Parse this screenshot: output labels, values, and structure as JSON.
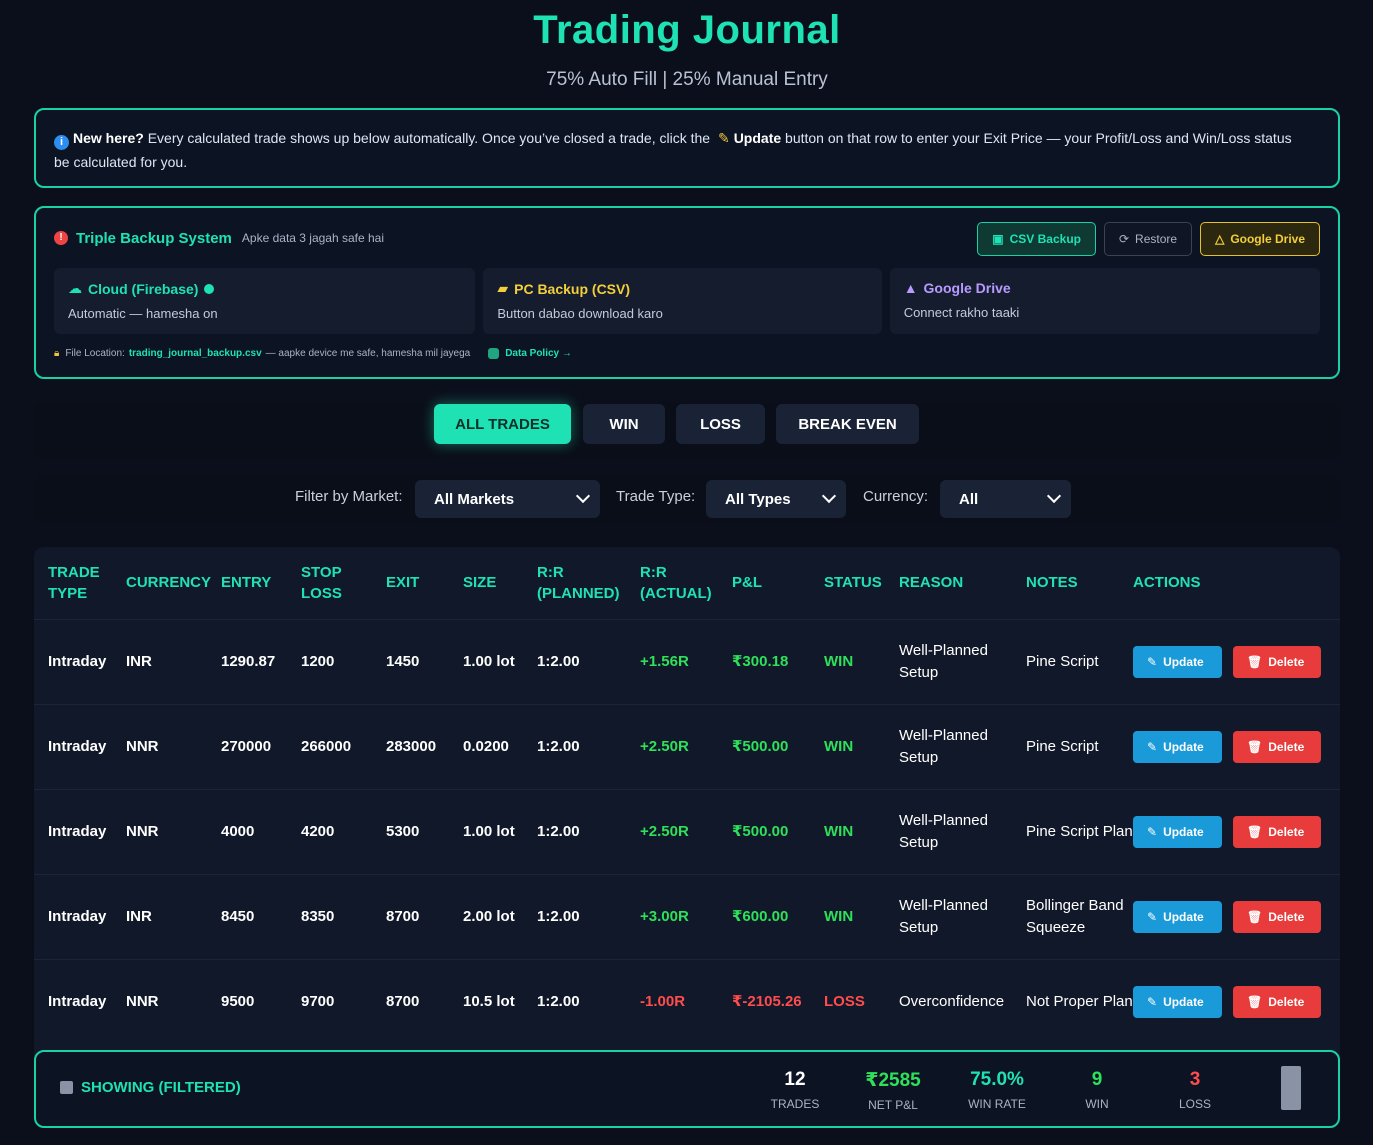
{
  "header": {
    "title": "Trading Journal",
    "subtitle": "75% Auto Fill | 25% Manual Entry"
  },
  "info": {
    "icon": "info-icon",
    "lead": "New here?",
    "text1": " Every calculated trade shows up below automatically. Once you’ve closed a trade, click the ",
    "update_word": "Update",
    "text2": " button on that row to enter your Exit Price — your Profit/Loss and Win/Loss status ",
    "text3": "be calculated for you."
  },
  "backup": {
    "title": "Triple Backup System",
    "subtitle": "Apke data 3 jagah safe hai",
    "buttons": {
      "csv": "CSV Backup",
      "restore": "Restore",
      "gdrive": "Google Drive"
    },
    "cards": [
      {
        "title": "Cloud (Firebase)",
        "sub": "Automatic — hamesha on",
        "icon": "cloud-icon"
      },
      {
        "title": "PC Backup (CSV)",
        "sub": "Button dabao download karo",
        "icon": "folder-icon"
      },
      {
        "title": "Google Drive",
        "sub": "Connect rakho taaki",
        "icon": "drive-icon"
      }
    ],
    "file_label": "File Location:",
    "file_name": "trading_journal_backup.csv",
    "file_note": "— aapke device me safe, hamesha mil jayega",
    "data_policy": "Data Policy →"
  },
  "tabs": [
    "ALL TRADES",
    "WIN",
    "LOSS",
    "BREAK EVEN"
  ],
  "filters": {
    "market_label": "Filter by Market:",
    "market_value": "All Markets",
    "type_label": "Trade Type:",
    "type_value": "All Types",
    "currency_label": "Currency:",
    "currency_value": "All"
  },
  "table": {
    "headers": [
      "TRADE TYPE",
      "CURRENCY",
      "ENTRY",
      "STOP LOSS",
      "EXIT",
      "SIZE",
      "R:R (PLANNED)",
      "R:R (ACTUAL)",
      "P&L",
      "STATUS",
      "REASON",
      "NOTES",
      "ACTIONS"
    ],
    "update_label": "Update",
    "delete_label": "Delete",
    "rows": [
      {
        "type": "Intraday",
        "currency": "INR",
        "entry": "1290.87",
        "stop": "1200",
        "exit": "1450",
        "size": "1.00 lot",
        "rr_planned": "1:2.00",
        "rr_actual": "+1.56R",
        "pnl": "₹300.18",
        "status": "WIN",
        "reason": "Well-Planned Setup",
        "notes": "Pine Script",
        "positive": true
      },
      {
        "type": "Intraday",
        "currency": "NNR",
        "entry": "270000",
        "stop": "266000",
        "exit": "283000",
        "size": "0.0200",
        "rr_planned": "1:2.00",
        "rr_actual": "+2.50R",
        "pnl": "₹500.00",
        "status": "WIN",
        "reason": "Well-Planned Setup",
        "notes": "Pine Script",
        "positive": true
      },
      {
        "type": "Intraday",
        "currency": "NNR",
        "entry": "4000",
        "stop": "4200",
        "exit": "5300",
        "size": "1.00 lot",
        "rr_planned": "1:2.00",
        "rr_actual": "+2.50R",
        "pnl": "₹500.00",
        "status": "WIN",
        "reason": "Well-Planned Setup",
        "notes": "Pine Script Plan",
        "positive": true
      },
      {
        "type": "Intraday",
        "currency": "INR",
        "entry": "8450",
        "stop": "8350",
        "exit": "8700",
        "size": "2.00 lot",
        "rr_planned": "1:2.00",
        "rr_actual": "+3.00R",
        "pnl": "₹600.00",
        "status": "WIN",
        "reason": "Well-Planned Setup",
        "notes": "Bollinger Band Squeeze",
        "positive": true
      },
      {
        "type": "Intraday",
        "currency": "NNR",
        "entry": "9500",
        "stop": "9700",
        "exit": "8700",
        "size": "10.5 lot",
        "rr_planned": "1:2.00",
        "rr_actual": "-1.00R",
        "pnl": "₹-2105.26",
        "status": "LOSS",
        "reason": "Overconfidence",
        "notes": "Not Proper Plan",
        "positive": false
      }
    ]
  },
  "summary": {
    "title": "SHOWING (FILTERED)",
    "stats": [
      {
        "value": "12",
        "label": "TRADES",
        "color": "#ffffff"
      },
      {
        "value": "₹2585",
        "label": "NET P&L",
        "color": "#2ee05a"
      },
      {
        "value": "75.0%",
        "label": "WIN RATE",
        "color": "#1fe2b4"
      },
      {
        "value": "9",
        "label": "WIN",
        "color": "#2ee05a"
      },
      {
        "value": "3",
        "label": "LOSS",
        "color": "#ff4d4d"
      }
    ]
  },
  "colors": {
    "accent": "#1fe2b4",
    "win": "#2ee05a",
    "loss": "#ff4d4d",
    "update": "#1a9ad9",
    "delete": "#e83b3b"
  }
}
